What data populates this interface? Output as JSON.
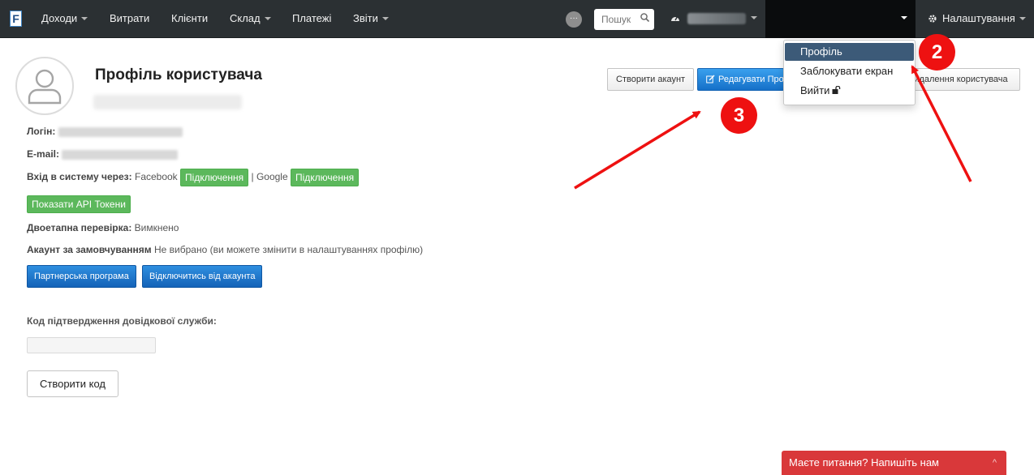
{
  "nav": {
    "logo_letter": "F",
    "items": [
      {
        "label": "Доходи",
        "has_caret": true
      },
      {
        "label": "Витрати",
        "has_caret": false
      },
      {
        "label": "Клієнти",
        "has_caret": false
      },
      {
        "label": "Склад",
        "has_caret": true
      },
      {
        "label": "Платежі",
        "has_caret": false
      },
      {
        "label": "Звіти",
        "has_caret": true
      }
    ],
    "dot_badge": "···",
    "search_placeholder": "Пошук",
    "settings_label": "Налаштування"
  },
  "dropdown": {
    "items": [
      {
        "label": "Профіль",
        "active": true
      },
      {
        "label": "Заблокувати екран",
        "active": false
      },
      {
        "label": "Вийти",
        "active": false
      }
    ]
  },
  "profile": {
    "title": "Профіль користувача",
    "buttons": {
      "create_account": "Створити акаунт",
      "edit_profile": "Редагувати Профіль",
      "delete_user": "Видалення користувача"
    },
    "login_label": "Логін:",
    "email_label": "E-mail:",
    "login_via_label": "Вхід в систему через:",
    "facebook_label": "Facebook",
    "connect_label": "Підключення",
    "separator": "|",
    "google_label": "Google",
    "api_tokens_button": "Показати API Токени",
    "two_factor_label": "Двоетапна перевірка:",
    "two_factor_value": "Вимкнено",
    "default_account_label": "Акаунт за замовчуванням",
    "default_account_value": "Не вибрано (ви можете змінити в налаштуваннях профілю)",
    "partner_button": "Партнерська програма",
    "disconnect_button": "Відключитись від акаунта",
    "support_code_label": "Код підтвердження довідкової служби:",
    "create_code_button": "Створити код"
  },
  "chat": {
    "label": "Маєте питання? Напишіть нам",
    "chevron": "^"
  },
  "annotations": {
    "badge_2": "2",
    "badge_3": "3"
  },
  "colors": {
    "navbar": "#2b3033",
    "dropdown_active": "#3c5a78",
    "primary_button": "#1570c8",
    "success_button": "#5cb85c",
    "chat_bar": "#d9383a",
    "annotation_red": "#ee1111"
  }
}
